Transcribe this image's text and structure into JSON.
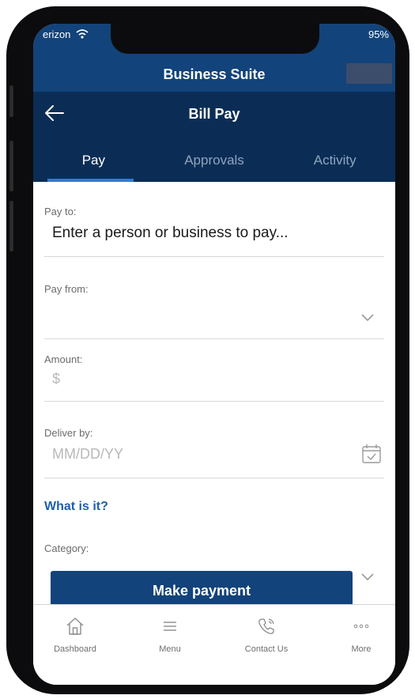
{
  "status": {
    "carrier": "erizon",
    "battery": "95%"
  },
  "header": {
    "app_title": "Business Suite",
    "screen_title": "Bill Pay"
  },
  "tabs": [
    {
      "label": "Pay",
      "active": true
    },
    {
      "label": "Approvals",
      "active": false
    },
    {
      "label": "Activity",
      "active": false
    }
  ],
  "form": {
    "pay_to": {
      "label": "Pay to:",
      "value": "Enter a person or business to pay..."
    },
    "pay_from": {
      "label": "Pay from:",
      "value": ""
    },
    "amount": {
      "label": "Amount:",
      "placeholder": "$"
    },
    "deliver_by": {
      "label": "Deliver by:",
      "placeholder": "MM/DD/YY"
    },
    "what_is_it": "What is it?",
    "category": {
      "label": "Category:",
      "value": ""
    }
  },
  "actions": {
    "make_payment": "Make payment"
  },
  "bottom_nav": [
    {
      "label": "Dashboard",
      "icon": "home-icon"
    },
    {
      "label": "Menu",
      "icon": "menu-icon"
    },
    {
      "label": "Contact Us",
      "icon": "phone-icon"
    },
    {
      "label": "More",
      "icon": "more-icon"
    }
  ],
  "colors": {
    "header_blue": "#12437a",
    "nav_navy": "#0b2d55",
    "tab_indicator": "#2b7bdb",
    "link_blue": "#1f5fae"
  }
}
